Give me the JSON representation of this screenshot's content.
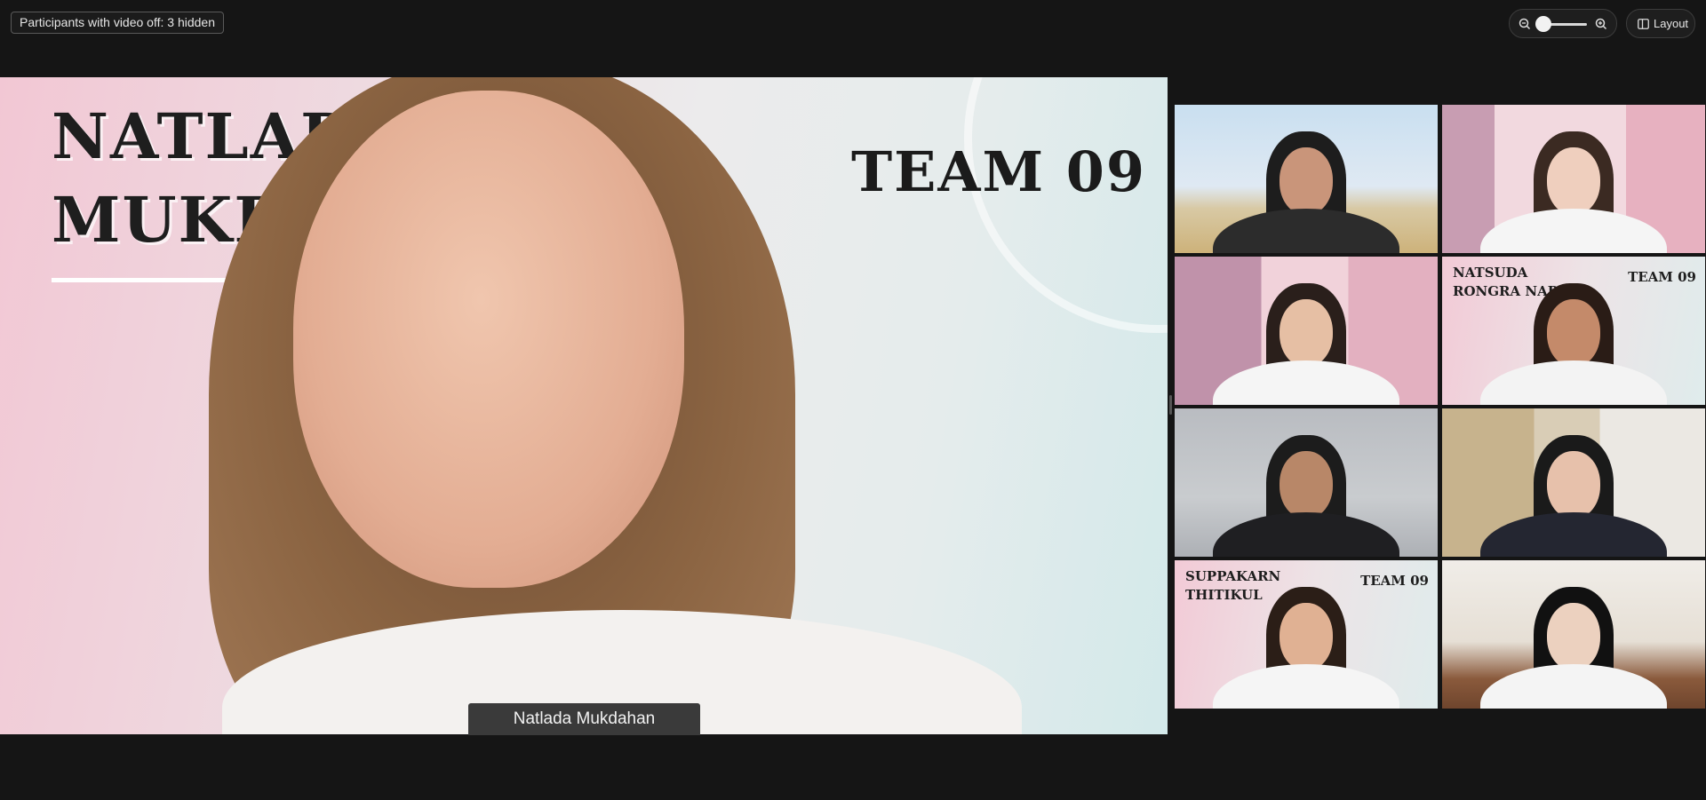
{
  "topbar": {
    "hidden_participants": "Participants with video off: 3 hidden",
    "zoom_out_icon": "zoom-out-icon",
    "zoom_in_icon": "zoom-in-icon",
    "layout_label": "Layout",
    "layout_icon": "layout-icon"
  },
  "main": {
    "speaker_name": "Natlada Mukdahan",
    "slide_name_line1": "NATLAD",
    "slide_name_line2": "MUKDA",
    "slide_team": "TEAM 09"
  },
  "gallery": {
    "tiles": [
      {
        "bg": "classroom-game-backdrop"
      },
      {
        "bg": "pink-squares"
      },
      {
        "bg": "pink-squares"
      },
      {
        "bg": "name-slide",
        "name1": "NATSUDA",
        "name2": "RONGRA    NAPAN",
        "team": "TEAM 09"
      },
      {
        "bg": "grey-wall"
      },
      {
        "bg": "bookshelf-office"
      },
      {
        "bg": "name-slide",
        "name1": "SUPPAKARN",
        "name2": "THITIKUL",
        "team": "TEAM 09"
      },
      {
        "bg": "room"
      }
    ]
  },
  "colors": {
    "app_background": "#151515",
    "name_tag": "#3a3a3a"
  }
}
